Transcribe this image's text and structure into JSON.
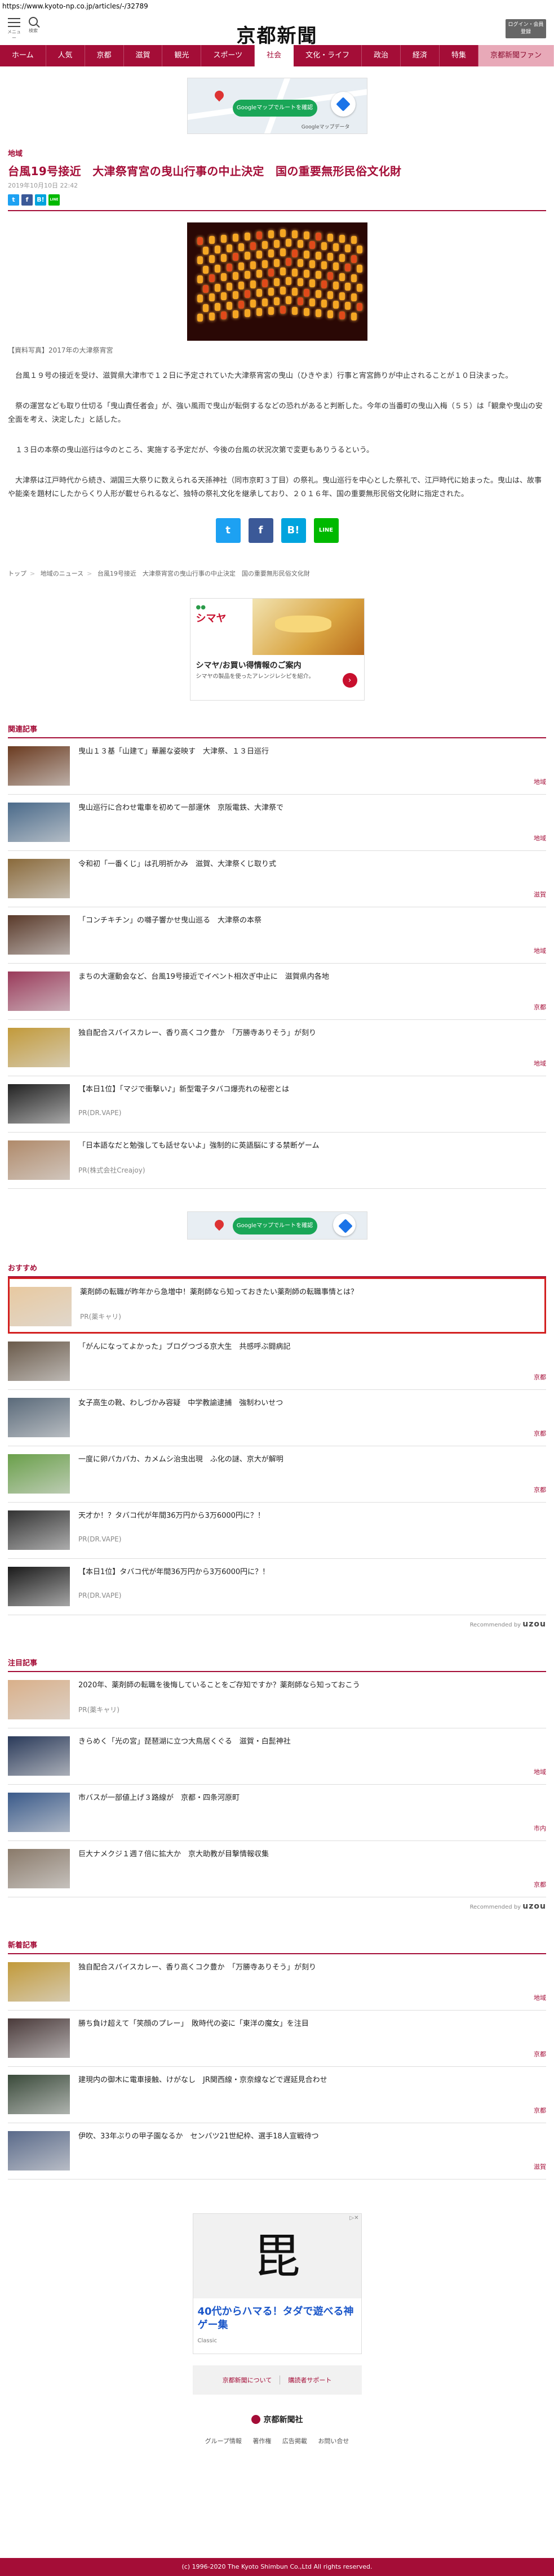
{
  "browser": {
    "url": "https://www.kyoto-np.co.jp/articles/-/32789"
  },
  "header": {
    "menu_label": "メニュー",
    "search_label": "検索",
    "logo": "京都新聞",
    "login_line1": "ログイン・会員",
    "login_line2": "登録"
  },
  "nav": [
    {
      "label": "ホーム"
    },
    {
      "label": "人気"
    },
    {
      "label": "京都"
    },
    {
      "label": "滋賀"
    },
    {
      "label": "観光"
    },
    {
      "label": "スポーツ"
    },
    {
      "label": "社会"
    },
    {
      "label": "文化・ライフ"
    },
    {
      "label": "政治"
    },
    {
      "label": "経済"
    },
    {
      "label": "特集"
    },
    {
      "label": "京都新聞ファン"
    }
  ],
  "ads": {
    "map_pill": "Googleマップでルートを確認",
    "map_source": "Googleマップデータ"
  },
  "article": {
    "category": "地域",
    "headline": "台風19号接近　大津祭宵宮の曳山行事の中止決定　国の重要無形民俗文化財",
    "date": "2019年10月10日 22:42",
    "caption": "【資料写真】2017年の大津祭宵宮",
    "paragraphs": [
      "台風１９号の接近を受け、滋賀県大津市で１２日に予定されていた大津祭宵宮の曳山（ひきやま）行事と宵宮飾りが中止されることが１０日決まった。",
      "祭の運営なども取り仕切る「曳山責任者会」が、強い風雨で曳山が転倒するなどの恐れがあると判断した。今年の当番町の曳山入梅（５５）は「観衆や曳山の安全面を考え、決定した」と話した。",
      "１３日の本祭の曳山巡行は今のところ、実施する予定だが、今後の台風の状況次第で変更もありうるという。",
      "大津祭は江戸時代から続き、湖国三大祭りに数えられる天孫神社（同市京町３丁目）の祭礼。曳山巡行を中心とした祭礼で、江戸時代に始まった。曳山は、故事や能楽を題材にしたからくり人形が載せられるなど、独特の祭礼文化を継承しており、２０１６年、国の重要無形民俗文化財に指定された。"
    ]
  },
  "share": {
    "twitter": "t",
    "facebook": "f",
    "hatena": "B!",
    "line": "LINE"
  },
  "breadcrumb": [
    "トップ",
    "地域のニュース",
    "台風19号接近　大津祭宵宮の曳山行事の中止決定　国の重要無形民俗文化財"
  ],
  "promo": {
    "brand": "シマヤ",
    "title": "シマヤ/お買い得情報のご案内",
    "desc": "シマヤの製品を使ったアレンジレシピを紹介。"
  },
  "related": {
    "heading": "関連記事",
    "items": [
      {
        "title": "曳山１３基「山建て」華麗な姿映す　大津祭、１３日巡行",
        "tag": "地域",
        "thumb": "#6b3b20"
      },
      {
        "title": "曳山巡行に合わせ電車を初めて一部運休　京阪電鉄、大津祭で",
        "tag": "地域",
        "thumb": "#4a6a8a"
      },
      {
        "title": "令和初「一番くじ」は孔明祈かみ　滋賀、大津祭くじ取り式",
        "tag": "滋賀",
        "thumb": "#8a6a3b"
      },
      {
        "title": "「コンチキチン」の囃子響かせ曳山巡る　大津祭の本祭",
        "tag": "地域",
        "thumb": "#5a3a2a"
      },
      {
        "title": "まちの大運動会など、台風19号接近でイベント相次ぎ中止に　滋賀県内各地",
        "tag": "京都",
        "thumb": "#9a3a5a"
      },
      {
        "title": "独自配合スパイスカレー、香り高くコク豊か　「万勝寺ありそう」が刻り",
        "tag": "地域",
        "thumb": "#c29a3a"
      },
      {
        "title": "【本日1位】「マジで衝撃い♪」新型電子タバコ爆売れの秘密とは",
        "pr": "PR(DR.VAPE)",
        "thumb": "#222222"
      },
      {
        "title": "「日本語なだと勉強しても話せないよ」強制的に英語脳にする禁断ゲーム",
        "pr": "PR(株式会社Creajoy)",
        "thumb": "#b08a6a"
      }
    ]
  },
  "recommend": {
    "heading": "おすすめ",
    "items": [
      {
        "title": "薬剤師の転職が昨年から急増中！薬剤師なら知っておきたい薬剤師の転職事情とは？",
        "pr": "PR(薬キャリ)",
        "thumb": "#e8c9a0"
      },
      {
        "title": "「がんになってよかった」ブログつづる京大生　共感呼ぶ闘病記",
        "tag": "京都",
        "thumb": "#6a5a4a"
      },
      {
        "title": "女子高生の靴、わしづかみ容疑　中学教諭逮捕　強制わいせつ",
        "tag": "京都",
        "thumb": "#5a6a7a"
      },
      {
        "title": "一度に卵パカパカ、カメムシ治虫出現　ふ化の謎、京大が解明",
        "tag": "京都",
        "thumb": "#6aa04a"
      },
      {
        "title": "天才か！？タバコ代が年間36万円から3万6000円に？！",
        "pr": "PR(DR.VAPE)",
        "thumb": "#333333"
      },
      {
        "title": "【本日1位】タバコ代が年間36万円から3万6000円に？！",
        "pr": "PR(DR.VAPE)",
        "thumb": "#1a1a1a"
      }
    ],
    "credit_small": "Recommended by",
    "credit_brand": "uzou"
  },
  "featured": {
    "heading": "注目記事",
    "items": [
      {
        "title": "2020年、薬剤師の転職を後悔していることをご存知ですか？薬剤師なら知っておこう",
        "pr": "PR(薬キャリ)",
        "thumb": "#d9b08a"
      },
      {
        "title": "きらめく「光の宮」琵琶湖に立つ大鳥居くぐる　滋賀・白髭神社",
        "tag": "地域",
        "thumb": "#2a3a5a"
      },
      {
        "title": "市バスが一部値上げ３路線が　京都・四条河原町",
        "tag": "市内",
        "thumb": "#3a5a8a"
      },
      {
        "title": "巨大ナメクジ１週７倍に拡大か　京大助教が目撃情報収集",
        "tag": "京都",
        "thumb": "#8a7a6a"
      }
    ],
    "credit_small": "Recommended by",
    "credit_brand": "uzou"
  },
  "latest": {
    "heading": "新着記事",
    "items": [
      {
        "title": "独自配合スパイスカレー、香り高くコク豊か　「万勝寺ありそう」が刻り",
        "tag": "地域",
        "thumb": "#c29a3a"
      },
      {
        "title": "勝ち負け超えて「笑顔のプレー」　敗時代の姿に「東洋の魔女」を注目",
        "tag": "京都",
        "thumb": "#4a3a3a"
      },
      {
        "title": "建現内の御木に電車接触、けがなし　JR関西線・京奈線などで遅延見合わせ",
        "tag": "京都",
        "thumb": "#3a4a3a"
      },
      {
        "title": "伊吹、33年ぶりの甲子園なるか　センバツ21世紀枠、選手18人宣戦待つ",
        "tag": "滋賀",
        "thumb": "#5a6a8a"
      }
    ]
  },
  "game_ad": {
    "kanji": "毘",
    "title": "40代からハマる！タダで遊べる神ゲー集",
    "advertiser": "Classic"
  },
  "footer": {
    "link1": "京都新聞について",
    "link2": "購読者サポート",
    "brand": "京都新聞社",
    "links": [
      "グループ情報",
      "著作権",
      "広告掲載",
      "お問い合せ"
    ],
    "copyright": "(c) 1996-2020 The Kyoto Shimbun Co.,Ltd All rights reserved."
  }
}
